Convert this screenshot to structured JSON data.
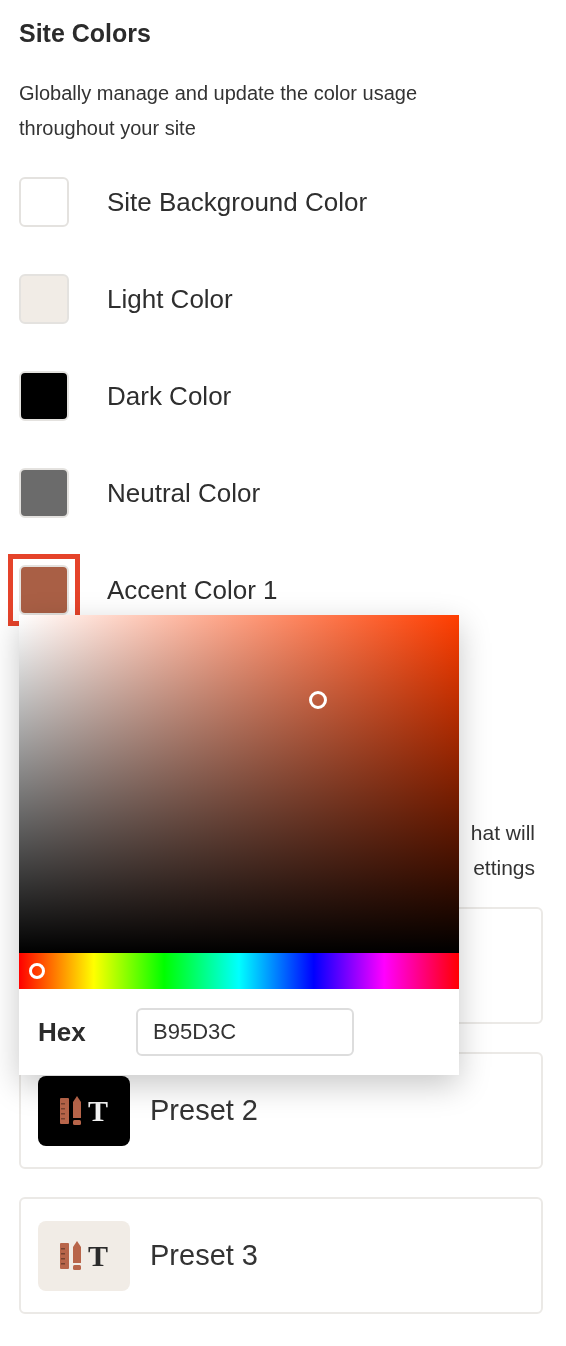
{
  "title": "Site Colors",
  "description": "Globally manage and update the color usage throughout your site",
  "colors": [
    {
      "label": "Site Background Color",
      "color": "#ffffff",
      "selected": false
    },
    {
      "label": "Light Color",
      "color": "#f1ece6",
      "selected": false
    },
    {
      "label": "Dark Color",
      "color": "#000000",
      "selected": false
    },
    {
      "label": "Neutral Color",
      "color": "#6b6b6b",
      "selected": false
    },
    {
      "label": "Accent Color 1",
      "color": "#a95f45",
      "selected": true
    }
  ],
  "presets_description_lines": [
    "hat will",
    "ettings"
  ],
  "presets": [
    {
      "label": "Preset 2",
      "icon_letter": "T",
      "color": "#000000"
    },
    {
      "label": "Preset 3",
      "icon_letter": "T",
      "color": "#f1ece6"
    }
  ],
  "color_picker": {
    "hue": {
      "level": 0.04
    },
    "hex_label": "Hex",
    "hex_value": "B95D3C"
  }
}
